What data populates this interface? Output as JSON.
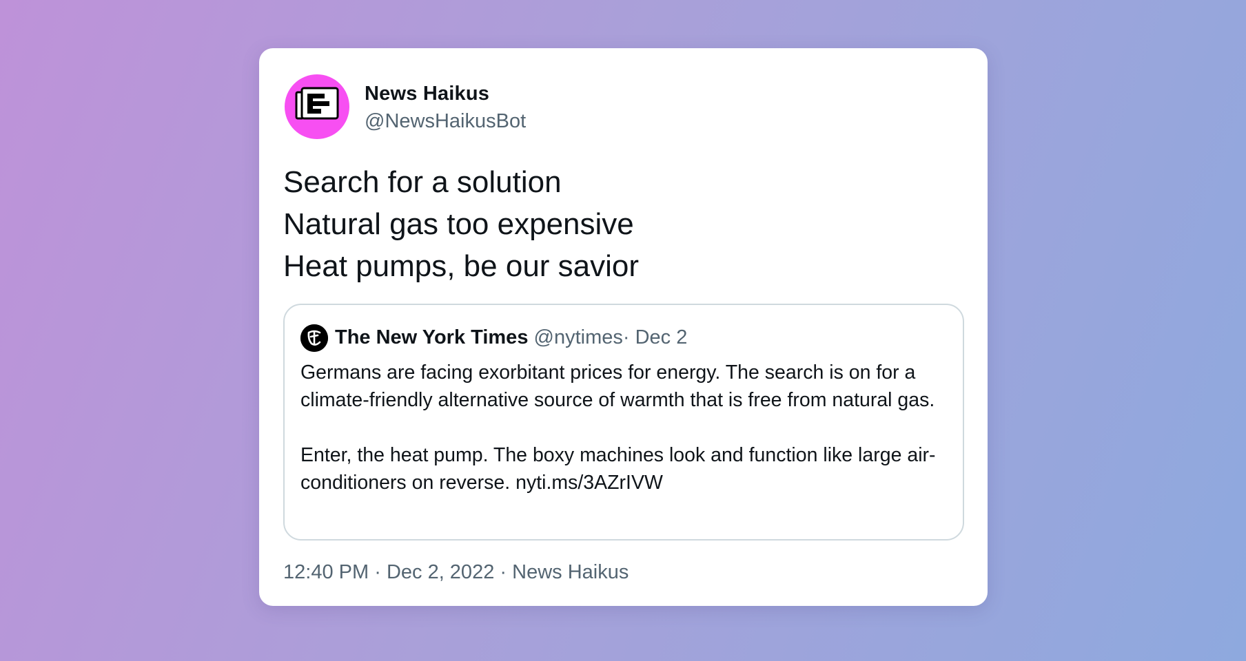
{
  "author": {
    "name": "News Haikus",
    "handle": "@NewsHaikusBot",
    "avatar_icon": "newspaper-icon",
    "avatar_color": "#f74ff2"
  },
  "haiku": {
    "line1": "Search for a solution",
    "line2": "Natural gas too expensive",
    "line3": "Heat pumps, be our savior"
  },
  "quoted": {
    "logo_icon": "nyt-logo-icon",
    "name": "The New York Times",
    "handle": "@nytimes",
    "date": "· Dec 2",
    "paragraph1": "Germans are facing exorbitant prices for energy. The search is on for a climate-friendly alternative source of warmth that is free from natural gas.",
    "paragraph2": "Enter, the heat pump. The boxy machines look and function like large air-conditioners on reverse.",
    "link": "nyti.ms/3AZrIVW"
  },
  "footer": {
    "time": "12:40 PM",
    "separator": "·",
    "date": "Dec 2, 2022",
    "source": "News Haikus"
  },
  "colors": {
    "text": "#0f1419",
    "muted": "#536471",
    "border": "#cfd9de",
    "background_start": "#be92d9",
    "background_end": "#8ea9de"
  }
}
